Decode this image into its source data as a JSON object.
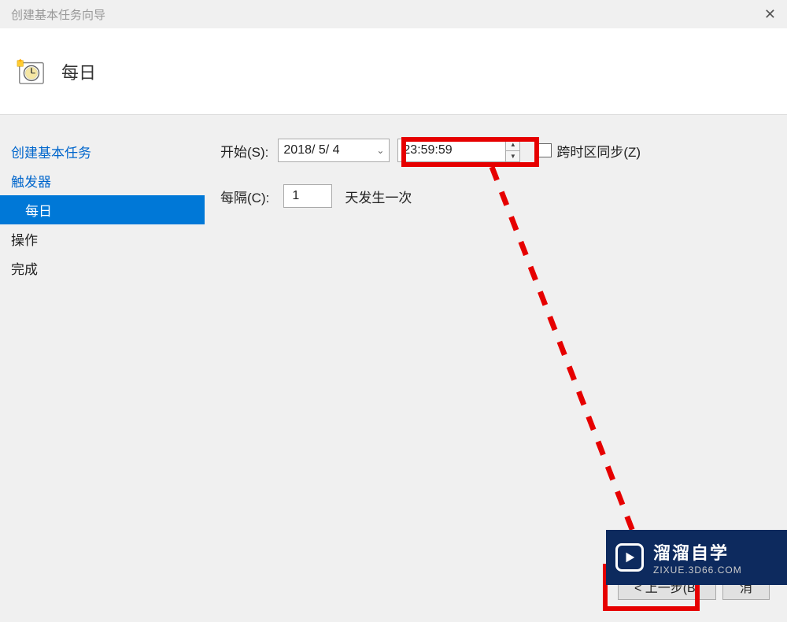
{
  "window": {
    "title": "创建基本任务向导"
  },
  "header": {
    "title": "每日"
  },
  "sidebar": {
    "items": [
      {
        "label": "创建基本任务",
        "link": true,
        "active": false,
        "sub": false
      },
      {
        "label": "触发器",
        "link": true,
        "active": false,
        "sub": false
      },
      {
        "label": "每日",
        "link": false,
        "active": true,
        "sub": true
      },
      {
        "label": "操作",
        "link": false,
        "active": false,
        "sub": false
      },
      {
        "label": "完成",
        "link": false,
        "active": false,
        "sub": false
      }
    ]
  },
  "form": {
    "startLabel": "开始(S):",
    "dateValue": "2018/ 5/ 4",
    "timeValue": "23:59:59",
    "syncLabel": "跨时区同步(Z)",
    "intervalLabel": "每隔(C):",
    "intervalValue": "1",
    "intervalSuffix": "天发生一次"
  },
  "buttons": {
    "back": "< 上一步(B)",
    "cancel": "消"
  },
  "watermark": {
    "line1": "溜溜自学",
    "line2": "ZIXUE.3D66.COM"
  }
}
